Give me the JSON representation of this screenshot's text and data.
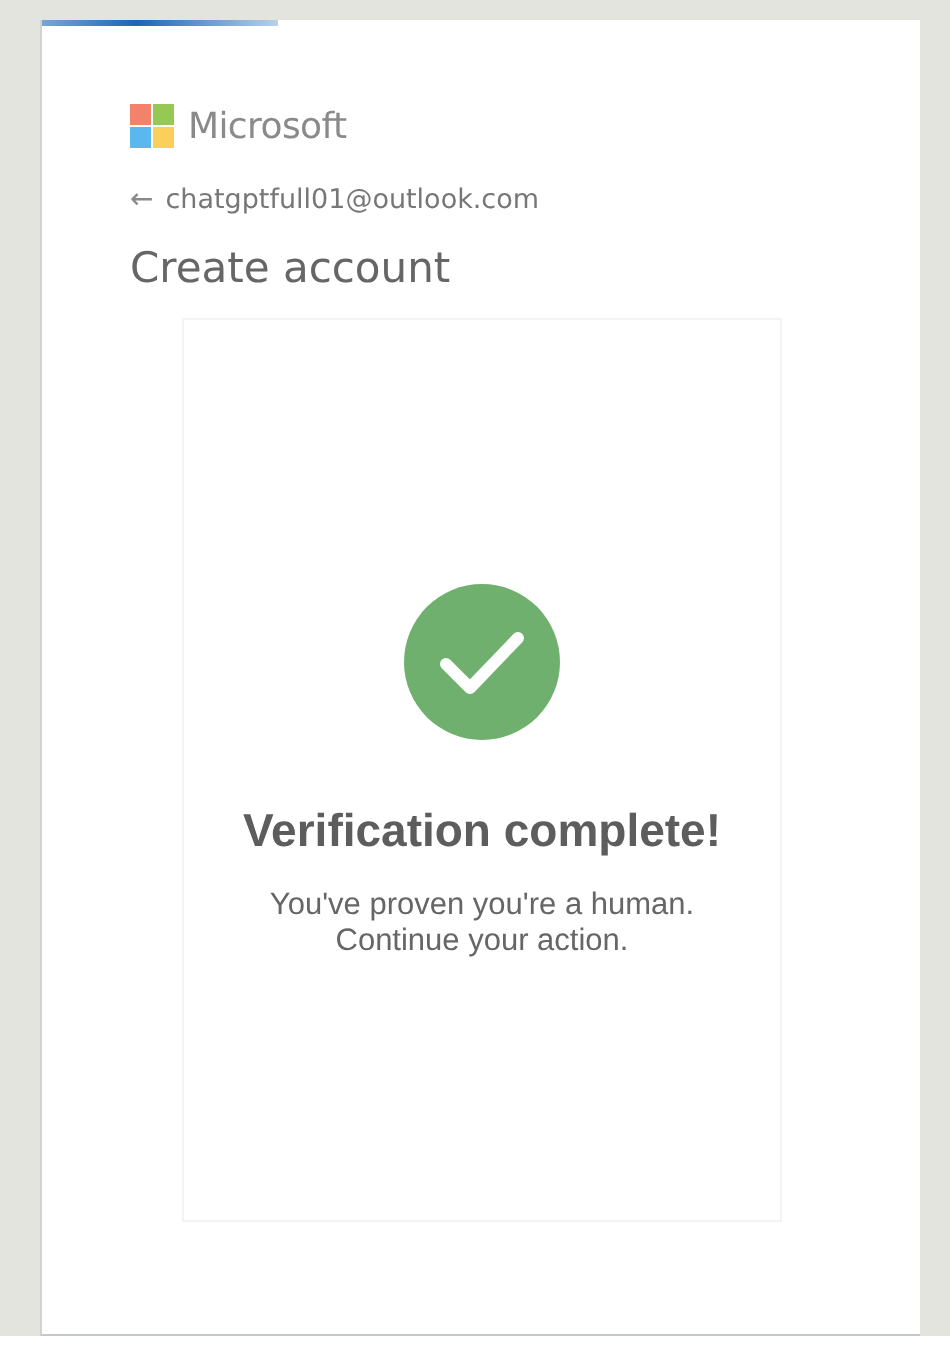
{
  "brand": {
    "name": "Microsoft"
  },
  "identity": {
    "back_arrow": "←",
    "email": "chatgptfull01@outlook.com"
  },
  "heading": "Create account",
  "verification": {
    "verified": true,
    "title": "Verification complete!",
    "lines": [
      "You've proven you're a human.",
      "Continue your action."
    ]
  }
}
